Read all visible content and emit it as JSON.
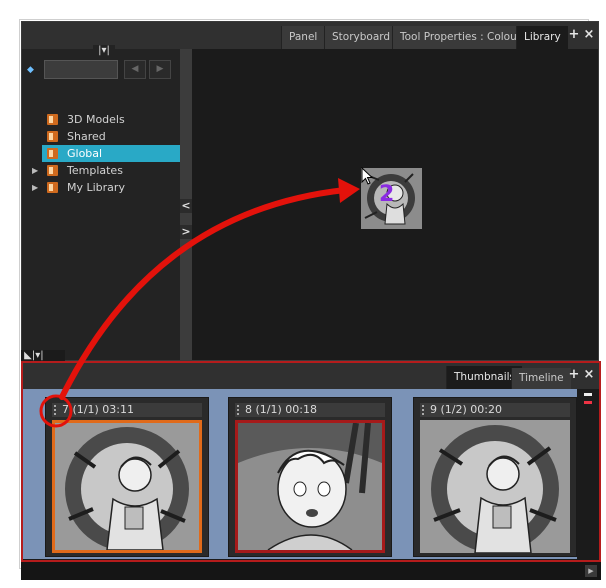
{
  "library_panel": {
    "tabs": [
      "Panel",
      "Storyboard",
      "Tool Properties : Colour",
      "Library"
    ],
    "active_tab": "Library",
    "add_button": "+",
    "close_button": "×",
    "search": {
      "value": "",
      "placeholder": ""
    },
    "tree": [
      {
        "label": "3D Models",
        "selected": false,
        "expandable": false
      },
      {
        "label": "Shared",
        "selected": false,
        "expandable": false
      },
      {
        "label": "Global",
        "selected": true,
        "expandable": false
      },
      {
        "label": "Templates",
        "selected": false,
        "expandable": true
      },
      {
        "label": "My Library",
        "selected": false,
        "expandable": true
      }
    ],
    "drag_preview_number": "2"
  },
  "thumbnails_panel": {
    "tabs": [
      "Thumbnails",
      "Timeline"
    ],
    "active_tab": "Thumbnails",
    "add_button": "+",
    "close_button": "×",
    "panels": [
      {
        "label": "7 (1/1) 03:11",
        "state": "selected"
      },
      {
        "label": "8 (1/1) 00:18",
        "state": "current"
      },
      {
        "label": "9 (1/2) 00:20",
        "state": "normal"
      }
    ]
  },
  "colors": {
    "accent_selected": "#29a9c6",
    "panel_selected": "#e06a1a",
    "panel_current": "#a51a1a",
    "annotation": "#e3120b",
    "strip_bg": "#7b93b7"
  }
}
